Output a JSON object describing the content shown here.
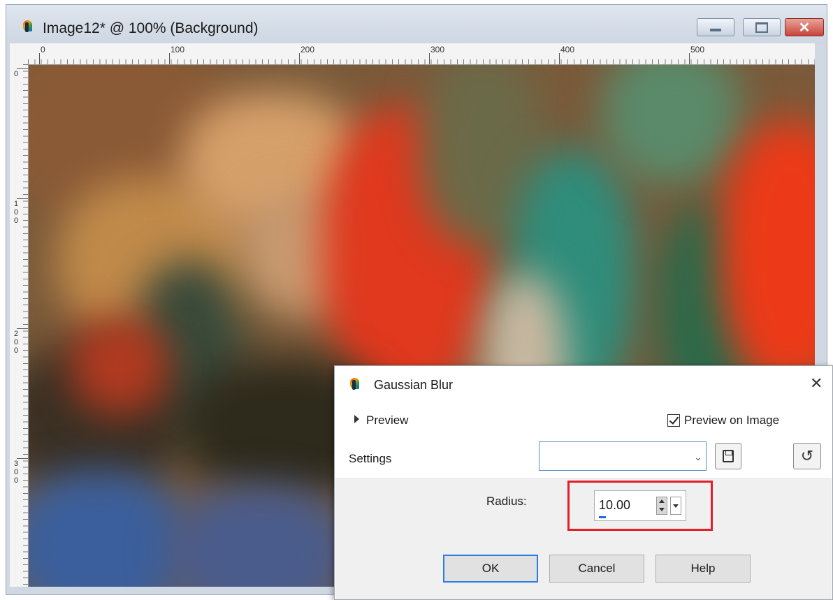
{
  "doc_window": {
    "title": "Image12* @ 100% (Background)",
    "controls": {
      "close_glyph": "✕"
    }
  },
  "ruler": {
    "top_labels": [
      "0",
      "100",
      "200",
      "300",
      "400",
      "500"
    ],
    "left_labels": [
      [
        "0"
      ],
      [
        "1",
        "0",
        "0"
      ],
      [
        "2",
        "0",
        "0"
      ],
      [
        "3",
        "0",
        "0"
      ]
    ]
  },
  "dialog": {
    "title": "Gaussian Blur",
    "close_glyph": "✕",
    "preview_label": "Preview",
    "preview_on_image_label": "Preview on Image",
    "preview_on_image_checked": true,
    "settings_label": "Settings",
    "settings_value": "",
    "radius_label": "Radius:",
    "radius_value": "10.00",
    "buttons": {
      "ok": "OK",
      "cancel": "Cancel",
      "help": "Help"
    },
    "icons": [
      "app-icon",
      "save-preset-icon",
      "reset-icon",
      "close-icon",
      "expand-arrow-icon",
      "checkbox-icon",
      "dropdown-arrow-icon",
      "spin-icon"
    ]
  },
  "colors": {
    "highlight": "#e0202a",
    "accent": "#2a7de1"
  }
}
